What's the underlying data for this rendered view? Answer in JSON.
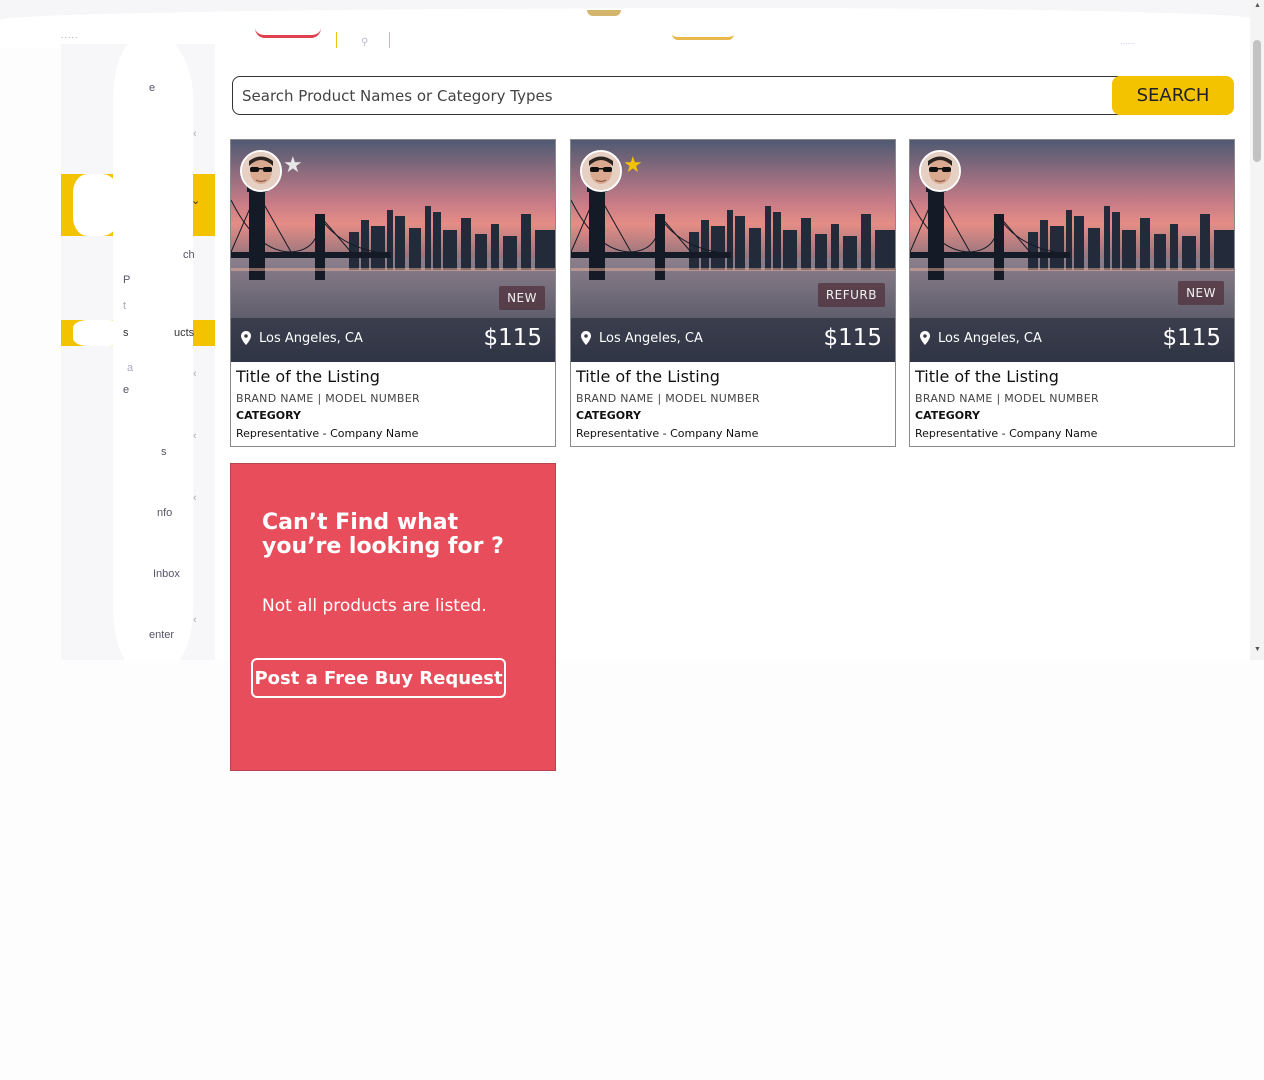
{
  "header": {
    "user_fragment": "......",
    "dots": "....."
  },
  "sidebar": {
    "texts": [
      "e",
      "ch",
      "P",
      "t",
      "s",
      "ucts",
      "a",
      "e",
      "s",
      "nfo",
      "Inbox",
      "enter"
    ]
  },
  "search": {
    "placeholder": "Search Product Names or Category Types",
    "button_label": "SEARCH"
  },
  "listings": [
    {
      "location": "Los Angeles, CA",
      "price": "$115",
      "condition": "NEW",
      "featured": false,
      "title": "Title of the Listing",
      "brand_model": "BRAND NAME | MODEL NUMBER",
      "category": "CATEGORY",
      "representative": "Representative - Company Name"
    },
    {
      "location": "Los Angeles, CA",
      "price": "$115",
      "condition": "REFURB",
      "featured": true,
      "title": "Title of the Listing",
      "brand_model": "BRAND NAME | MODEL NUMBER",
      "category": "CATEGORY",
      "representative": "Representative - Company Name"
    },
    {
      "location": "Los Angeles, CA",
      "price": "$115",
      "condition": "NEW",
      "featured": null,
      "title": "Title of the Listing",
      "brand_model": "BRAND NAME | MODEL NUMBER",
      "category": "CATEGORY",
      "representative": "Representative - Company Name"
    }
  ],
  "promo": {
    "heading": "Can’t Find what you’re looking for ?",
    "subtext": "Not all products are listed.",
    "button_label": "Post a Free Buy Request"
  },
  "colors": {
    "accent": "#f4c300",
    "promo": "#e84d5b",
    "star_active": "#f4c300",
    "star_inactive": "#e6e6e6"
  }
}
